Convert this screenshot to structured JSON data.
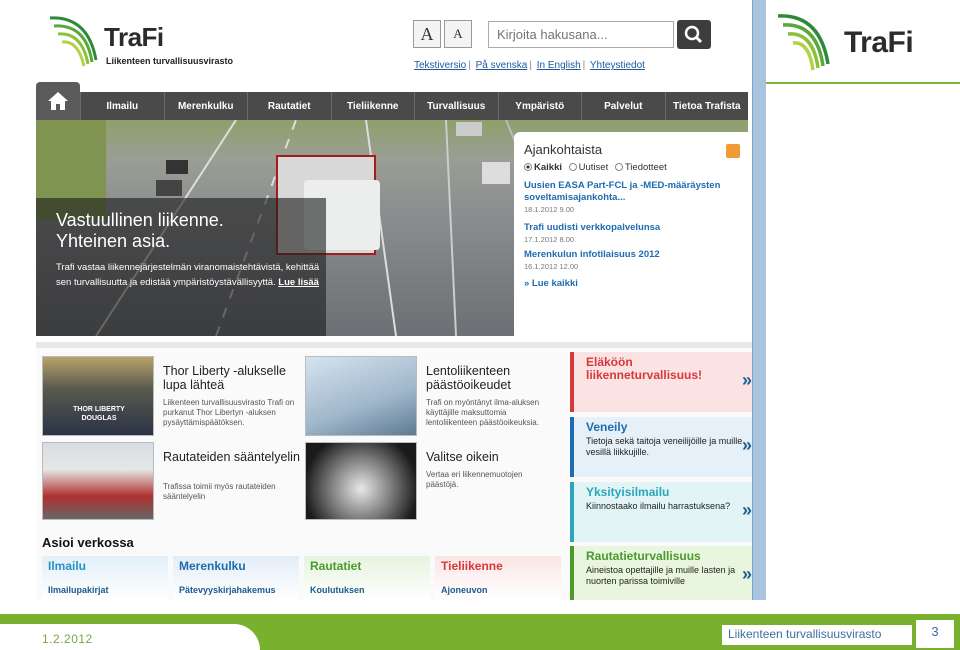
{
  "site": {
    "logo_text": "TraFi",
    "logo_subtitle": "Liikenteen turvallisuusvirasto",
    "font_large": "A",
    "font_small": "A",
    "search_placeholder": "Kirjoita hakusana...",
    "top_links": [
      "Tekstiversio",
      "På svenska",
      "In English",
      "Yhteystiedot"
    ]
  },
  "nav": {
    "items": [
      "Ilmailu",
      "Merenkulku",
      "Rautatiet",
      "Tieliikenne",
      "Turvallisuus",
      "Ympäristö",
      "Palvelut",
      "Tietoa Trafista"
    ]
  },
  "hero": {
    "title_line1": "Vastuullinen liikenne.",
    "title_line2": "Yhteinen asia.",
    "text": "Trafi vastaa liikennejärjestelmän viranomaistehtävistä, kehittää sen turvallisuutta ja edistää ympäristöystävällisyyttä.",
    "link": "Lue lisää"
  },
  "news": {
    "title": "Ajankohtaista",
    "filters": [
      "Kaikki",
      "Uutiset",
      "Tiedotteet"
    ],
    "items": [
      {
        "title": "Uusien EASA Part-FCL ja -MED-määräysten soveltamisajankohta...",
        "date": "18.1.2012 9.00"
      },
      {
        "title": "Trafi uudisti verkkopalvelunsa",
        "date": "17.1.2012 8.00"
      },
      {
        "title": "Merenkulun infotilaisuus 2012",
        "date": "16.1.2012 12.00"
      }
    ],
    "more": "» Lue kaikki"
  },
  "cards": [
    {
      "title": "Thor Liberty -alukselle lupa lähteä",
      "text": "Liikenteen turvallisuusvirasto Trafi on purkanut Thor Libertyn -aluksen pysäyttämispäätöksen.",
      "image_label": "THOR LIBERTY DOUGLAS"
    },
    {
      "title": "Lentoliikenteen päästöoikeudet",
      "text": "Trafi on myöntänyt ilma-aluksen käyttäjille maksuttomia lentoliikenteen päästöoikeuksia."
    },
    {
      "title": "Rautateiden sääntelyelin",
      "text": "Trafissa toimii myös rautateiden sääntelyelin"
    },
    {
      "title": "Valitse oikein",
      "text": "Vertaa eri liikennemuotojen päästöjä."
    }
  ],
  "banners": [
    {
      "title": "Eläköön liikenneturvallisuus!",
      "text": "",
      "color": "#d8383b",
      "bg": "#fbe3e3"
    },
    {
      "title": "Veneily",
      "text": "Tietoja sekä taitoja veneilijöille ja muille vesillä liikkujille.",
      "color": "#1e6bb0",
      "bg": "#e6f0f8"
    },
    {
      "title": "Yksityisilmailu",
      "text": "Kiinnostaako ilmailu harrastuksena?",
      "color": "#2aa6b8",
      "bg": "#e3f4f7"
    },
    {
      "title": "Rautatieturvallisuus",
      "text": "Aineistoa opettajille ja muille lasten ja nuorten parissa toimiville",
      "color": "#4a9a2c",
      "bg": "#e8f5df"
    }
  ],
  "online": {
    "title": "Asioi verkossa",
    "services": [
      {
        "title": "Ilmailu",
        "link": "Ilmailupakirjat",
        "color": "#2a8fc4",
        "bg": "#e1f0f8"
      },
      {
        "title": "Merenkulku",
        "link": "Pätevyyskirjahakemus",
        "color": "#1e6bb0",
        "bg": "#e3edf7"
      },
      {
        "title": "Rautatiet",
        "link": "Koulutuksen",
        "color": "#4a9a2c",
        "bg": "#e6f3de"
      },
      {
        "title": "Tieliikenne",
        "link": "Ajoneuvon",
        "color": "#d8383b",
        "bg": "#fbe5e5"
      }
    ]
  },
  "slide": {
    "logo_text": "TraFi",
    "date": "1.2.2012",
    "organization": "Liikenteen turvallisuusvirasto",
    "page_number": "3"
  }
}
